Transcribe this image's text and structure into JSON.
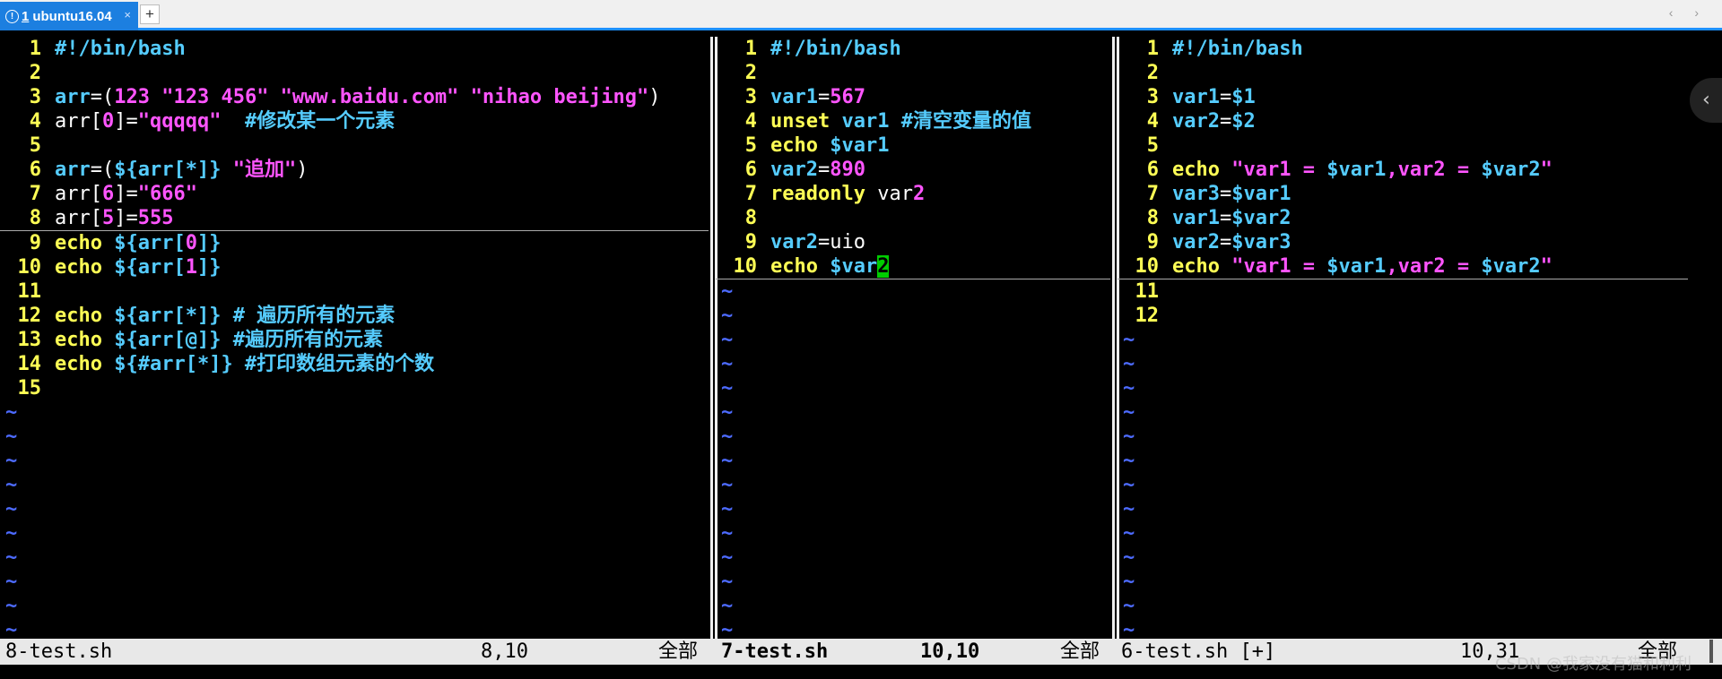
{
  "tabbar": {
    "tab_num": "1",
    "tab_title": "ubuntu16.04",
    "close_glyph": "×",
    "new_tab_glyph": "+",
    "nav_glyph": "‹ ›"
  },
  "side_button": {
    "glyph": "‹"
  },
  "colors": {
    "keyword": "#ffff55",
    "variable": "#55ccff",
    "string": "#ff55ff",
    "comment": "#55ccff",
    "plain": "#ffffff",
    "tilde": "#4d6bff",
    "cursor": "#00cc00"
  },
  "panes": [
    {
      "lines": [
        {
          "num": "1",
          "tokens": [
            {
              "t": "#!/bin/bash",
              "c": "variable"
            }
          ]
        },
        {
          "num": "2",
          "tokens": []
        },
        {
          "num": "3",
          "tokens": [
            {
              "t": "arr",
              "c": "variable"
            },
            {
              "t": "=(",
              "c": "plain"
            },
            {
              "t": "123 ",
              "c": "string"
            },
            {
              "t": "\"123 456\" \"www.baidu.com\" \"nihao beijing\"",
              "c": "string"
            },
            {
              "t": ")",
              "c": "plain"
            }
          ]
        },
        {
          "num": "4",
          "tokens": [
            {
              "t": "arr[",
              "c": "plain"
            },
            {
              "t": "0",
              "c": "string"
            },
            {
              "t": "]=",
              "c": "plain"
            },
            {
              "t": "\"qqqqq\"",
              "c": "string"
            },
            {
              "t": "  #修改某一个元素",
              "c": "comment"
            }
          ]
        },
        {
          "num": "5",
          "tokens": []
        },
        {
          "num": "6",
          "tokens": [
            {
              "t": "arr",
              "c": "variable"
            },
            {
              "t": "=(",
              "c": "plain"
            },
            {
              "t": "${arr[*]}",
              "c": "variable"
            },
            {
              "t": " \"追加\"",
              "c": "string"
            },
            {
              "t": ")",
              "c": "plain"
            }
          ]
        },
        {
          "num": "7",
          "tokens": [
            {
              "t": "arr[",
              "c": "plain"
            },
            {
              "t": "6",
              "c": "string"
            },
            {
              "t": "]=",
              "c": "plain"
            },
            {
              "t": "\"666\"",
              "c": "string"
            }
          ]
        },
        {
          "num": "8",
          "cursorline": true,
          "tokens": [
            {
              "t": "arr[",
              "c": "plain"
            },
            {
              "t": "5",
              "c": "string"
            },
            {
              "t": "]=",
              "c": "plain"
            },
            {
              "t": "555",
              "c": "string"
            }
          ]
        },
        {
          "num": "9",
          "tokens": [
            {
              "t": "echo ",
              "c": "keyword"
            },
            {
              "t": "${arr[",
              "c": "variable"
            },
            {
              "t": "0",
              "c": "string"
            },
            {
              "t": "]}",
              "c": "variable"
            }
          ]
        },
        {
          "num": "10",
          "tokens": [
            {
              "t": "echo ",
              "c": "keyword"
            },
            {
              "t": "${arr[",
              "c": "variable"
            },
            {
              "t": "1",
              "c": "string"
            },
            {
              "t": "]}",
              "c": "variable"
            }
          ]
        },
        {
          "num": "11",
          "tokens": []
        },
        {
          "num": "12",
          "tokens": [
            {
              "t": "echo ",
              "c": "keyword"
            },
            {
              "t": "${arr[*]}",
              "c": "variable"
            },
            {
              "t": " # 遍历所有的元素",
              "c": "comment"
            }
          ]
        },
        {
          "num": "13",
          "tokens": [
            {
              "t": "echo ",
              "c": "keyword"
            },
            {
              "t": "${arr[@]}",
              "c": "variable"
            },
            {
              "t": " #遍历所有的元素",
              "c": "comment"
            }
          ]
        },
        {
          "num": "14",
          "tokens": [
            {
              "t": "echo ",
              "c": "keyword"
            },
            {
              "t": "${#arr[*]}",
              "c": "variable"
            },
            {
              "t": " #打印数组元素的个数",
              "c": "comment"
            }
          ]
        },
        {
          "num": "15",
          "tokens": []
        }
      ],
      "tilde_count": 10
    },
    {
      "lines": [
        {
          "num": "1",
          "tokens": [
            {
              "t": "#!/bin/bash",
              "c": "variable"
            }
          ]
        },
        {
          "num": "2",
          "tokens": []
        },
        {
          "num": "3",
          "tokens": [
            {
              "t": "var1",
              "c": "variable"
            },
            {
              "t": "=",
              "c": "plain"
            },
            {
              "t": "567",
              "c": "string"
            }
          ]
        },
        {
          "num": "4",
          "tokens": [
            {
              "t": "unset ",
              "c": "keyword"
            },
            {
              "t": "var1",
              "c": "variable"
            },
            {
              "t": " #清空变量的值",
              "c": "comment"
            }
          ]
        },
        {
          "num": "5",
          "tokens": [
            {
              "t": "echo ",
              "c": "keyword"
            },
            {
              "t": "$var1",
              "c": "variable"
            }
          ]
        },
        {
          "num": "6",
          "tokens": [
            {
              "t": "var2",
              "c": "variable"
            },
            {
              "t": "=",
              "c": "plain"
            },
            {
              "t": "890",
              "c": "string"
            }
          ]
        },
        {
          "num": "7",
          "tokens": [
            {
              "t": "readonly ",
              "c": "keyword"
            },
            {
              "t": "var",
              "c": "plain"
            },
            {
              "t": "2",
              "c": "string"
            }
          ]
        },
        {
          "num": "8",
          "tokens": []
        },
        {
          "num": "9",
          "tokens": [
            {
              "t": "var2",
              "c": "variable"
            },
            {
              "t": "=uio",
              "c": "plain"
            }
          ]
        },
        {
          "num": "10",
          "cursorline": true,
          "tokens": [
            {
              "t": "echo ",
              "c": "keyword"
            },
            {
              "t": "$var",
              "c": "variable"
            },
            {
              "t": "2",
              "c": "cursor"
            }
          ]
        }
      ],
      "tilde_count": 15
    },
    {
      "lines": [
        {
          "num": "1",
          "tokens": [
            {
              "t": "#!/bin/bash",
              "c": "variable"
            }
          ]
        },
        {
          "num": "2",
          "tokens": []
        },
        {
          "num": "3",
          "tokens": [
            {
              "t": "var1",
              "c": "variable"
            },
            {
              "t": "=",
              "c": "plain"
            },
            {
              "t": "$1",
              "c": "variable"
            }
          ]
        },
        {
          "num": "4",
          "tokens": [
            {
              "t": "var2",
              "c": "variable"
            },
            {
              "t": "=",
              "c": "plain"
            },
            {
              "t": "$2",
              "c": "variable"
            }
          ]
        },
        {
          "num": "5",
          "tokens": []
        },
        {
          "num": "6",
          "tokens": [
            {
              "t": "echo ",
              "c": "keyword"
            },
            {
              "t": "\"var1 = ",
              "c": "string"
            },
            {
              "t": "$var1",
              "c": "variable"
            },
            {
              "t": ",var2 = ",
              "c": "string"
            },
            {
              "t": "$var2",
              "c": "variable"
            },
            {
              "t": "\"",
              "c": "string"
            }
          ]
        },
        {
          "num": "7",
          "tokens": [
            {
              "t": "var3",
              "c": "variable"
            },
            {
              "t": "=",
              "c": "plain"
            },
            {
              "t": "$var1",
              "c": "variable"
            }
          ]
        },
        {
          "num": "8",
          "tokens": [
            {
              "t": "var1",
              "c": "variable"
            },
            {
              "t": "=",
              "c": "plain"
            },
            {
              "t": "$var2",
              "c": "variable"
            }
          ]
        },
        {
          "num": "9",
          "tokens": [
            {
              "t": "var2",
              "c": "variable"
            },
            {
              "t": "=",
              "c": "plain"
            },
            {
              "t": "$var3",
              "c": "variable"
            }
          ]
        },
        {
          "num": "10",
          "cursorline": true,
          "tokens": [
            {
              "t": "echo ",
              "c": "keyword"
            },
            {
              "t": "\"var1 = ",
              "c": "string"
            },
            {
              "t": "$var1",
              "c": "variable"
            },
            {
              "t": ",var2 = ",
              "c": "string"
            },
            {
              "t": "$var2",
              "c": "variable"
            },
            {
              "t": "\"",
              "c": "string"
            }
          ]
        },
        {
          "num": "11",
          "tokens": []
        },
        {
          "num": "12",
          "tokens": []
        }
      ],
      "tilde_count": 13
    }
  ],
  "status": {
    "pane1": {
      "file": "8-test.sh",
      "pos": "8,10",
      "scroll": "全部"
    },
    "pane2": {
      "file": "7-test.sh",
      "pos": "10,10",
      "scroll": "全部"
    },
    "pane3": {
      "file": "6-test.sh [+]",
      "pos": "10,31",
      "scroll": "全部"
    }
  },
  "watermark": "CSDN @我家没有猫和利利"
}
